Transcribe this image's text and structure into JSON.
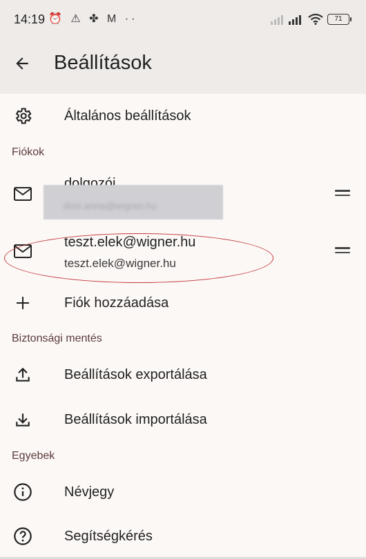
{
  "status": {
    "time": "14:19",
    "battery": "71",
    "left_icons": "⏰ ⚠ ✤ M ··"
  },
  "header": {
    "title": "Beállítások"
  },
  "general": {
    "label": "Általános beállítások"
  },
  "accounts": {
    "section": "Fiókok",
    "items": [
      {
        "name": "dolgozói",
        "email": "dosi.anna@wigner.hu"
      },
      {
        "name": "teszt.elek@wigner.hu",
        "email": "teszt.elek@wigner.hu"
      }
    ],
    "add_label": "Fiók hozzáadása"
  },
  "backup": {
    "section": "Biztonsági mentés",
    "export_label": "Beállítások exportálása",
    "import_label": "Beállítások importálása"
  },
  "other": {
    "section": "Egyebek",
    "about_label": "Névjegy",
    "help_label": "Segítségkérés"
  }
}
